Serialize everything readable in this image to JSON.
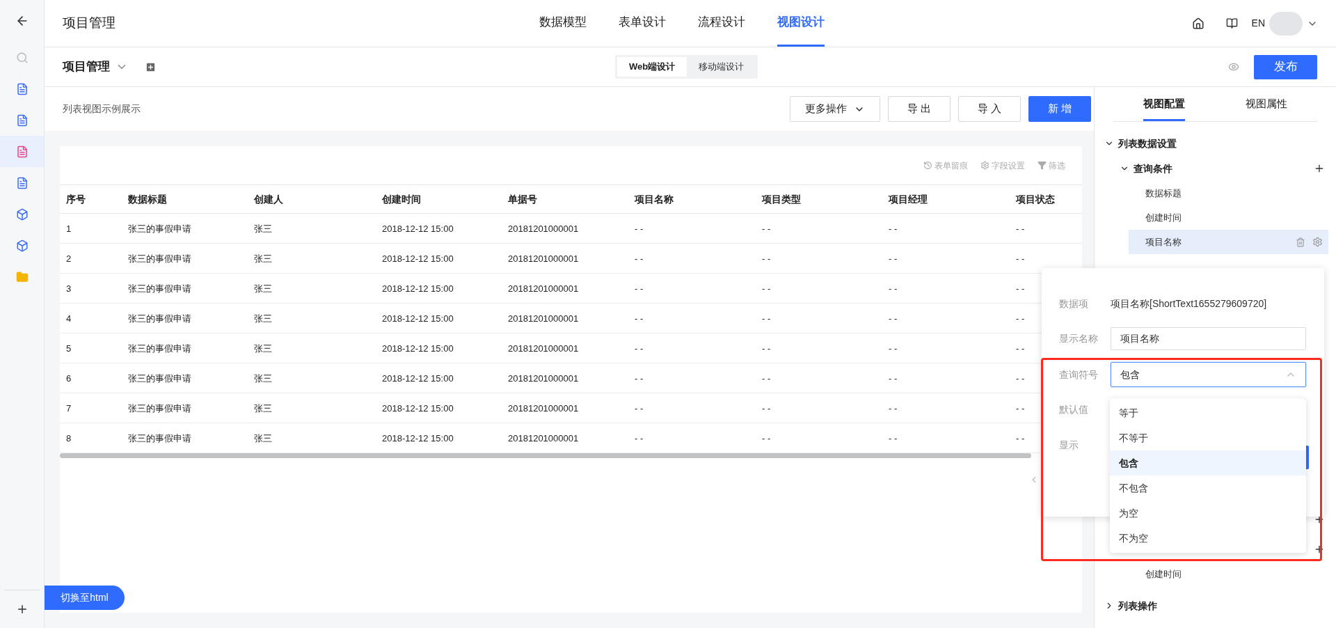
{
  "sidebar": {
    "items": [
      {
        "kind": "back",
        "selected": false
      },
      {
        "kind": "search",
        "selected": false
      },
      {
        "kind": "document",
        "selected": false
      },
      {
        "kind": "document",
        "selected": false
      },
      {
        "kind": "document",
        "selected": true
      },
      {
        "kind": "document",
        "selected": false
      },
      {
        "kind": "cube",
        "selected": false
      },
      {
        "kind": "cube",
        "selected": false
      },
      {
        "kind": "folder",
        "selected": false
      }
    ],
    "switch_button": "切换至html"
  },
  "header": {
    "title": "项目管理",
    "nav": [
      {
        "label": "数据模型",
        "selected": false
      },
      {
        "label": "表单设计",
        "selected": false
      },
      {
        "label": "流程设计",
        "selected": false
      },
      {
        "label": "视图设计",
        "selected": true
      }
    ],
    "language": "EN"
  },
  "subbar": {
    "title": "项目管理",
    "modes": [
      {
        "label": "Web端设计",
        "selected": true
      },
      {
        "label": "移动端设计",
        "selected": false
      }
    ],
    "publish": "发布"
  },
  "toolbar": {
    "caption": "列表视图示例展示",
    "buttons": [
      {
        "label": "更多操作",
        "kind": "dropdown"
      },
      {
        "label": "导 出",
        "kind": "default"
      },
      {
        "label": "导 入",
        "kind": "default"
      },
      {
        "label": "新 增",
        "kind": "primary"
      }
    ]
  },
  "table": {
    "tools": [
      {
        "label": "表单留痕",
        "kind": "history"
      },
      {
        "label": "字段设置",
        "kind": "settings"
      },
      {
        "label": "筛选",
        "kind": "filter"
      }
    ],
    "columns": [
      "序号",
      "数据标题",
      "创建人",
      "创建时间",
      "单据号",
      "项目名称",
      "项目类型",
      "项目经理",
      "项目状态"
    ],
    "rows": [
      [
        "1",
        "张三的事假申请",
        "张三",
        "2018-12-12 15:00",
        "20181201000001",
        "- -",
        "- -",
        "- -",
        "- -"
      ],
      [
        "2",
        "张三的事假申请",
        "张三",
        "2018-12-12 15:00",
        "20181201000001",
        "- -",
        "- -",
        "- -",
        "- -"
      ],
      [
        "3",
        "张三的事假申请",
        "张三",
        "2018-12-12 15:00",
        "20181201000001",
        "- -",
        "- -",
        "- -",
        "- -"
      ],
      [
        "4",
        "张三的事假申请",
        "张三",
        "2018-12-12 15:00",
        "20181201000001",
        "- -",
        "- -",
        "- -",
        "- -"
      ],
      [
        "5",
        "张三的事假申请",
        "张三",
        "2018-12-12 15:00",
        "20181201000001",
        "- -",
        "- -",
        "- -",
        "- -"
      ],
      [
        "6",
        "张三的事假申请",
        "张三",
        "2018-12-12 15:00",
        "20181201000001",
        "- -",
        "- -",
        "- -",
        "- -"
      ],
      [
        "7",
        "张三的事假申请",
        "张三",
        "2018-12-12 15:00",
        "20181201000001",
        "- -",
        "- -",
        "- -",
        "- -"
      ],
      [
        "8",
        "张三的事假申请",
        "张三",
        "2018-12-12 15:00",
        "20181201000001",
        "- -",
        "- -",
        "- -",
        "- -"
      ]
    ]
  },
  "panel": {
    "tabs": [
      {
        "label": "视图配置",
        "selected": true
      },
      {
        "label": "视图属性",
        "selected": false
      }
    ],
    "tree": [
      {
        "label": "列表数据设置",
        "expanded": true,
        "children": [
          {
            "label": "查询条件",
            "expanded": true,
            "children": [
              {
                "label": "数据标题",
                "selected": false
              },
              {
                "label": "创建时间",
                "selected": false
              },
              {
                "label": "项目名称",
                "selected": true
              }
            ]
          },
          {
            "children": [
              {
                "label": "创建时间",
                "selected": false
              }
            ]
          }
        ]
      },
      {
        "label": "列表操作",
        "expanded": false
      }
    ]
  },
  "popup": {
    "fields": [
      {
        "kind": "text",
        "label": "数据项",
        "value": "项目名称[ShortText1655279609720]"
      },
      {
        "kind": "input",
        "label": "显示名称",
        "value": "项目名称"
      },
      {
        "kind": "select",
        "label": "查询符号",
        "value": "包含",
        "expanded": true
      },
      {
        "kind": "input",
        "label": "默认值"
      },
      {
        "kind": "button",
        "label": "显示"
      }
    ],
    "options": [
      {
        "label": "等于",
        "selected": false
      },
      {
        "label": "不等于",
        "selected": false
      },
      {
        "label": "包含",
        "selected": true
      },
      {
        "label": "不包含",
        "selected": false
      },
      {
        "label": "为空",
        "selected": false
      },
      {
        "label": "不为空",
        "selected": false
      }
    ]
  }
}
